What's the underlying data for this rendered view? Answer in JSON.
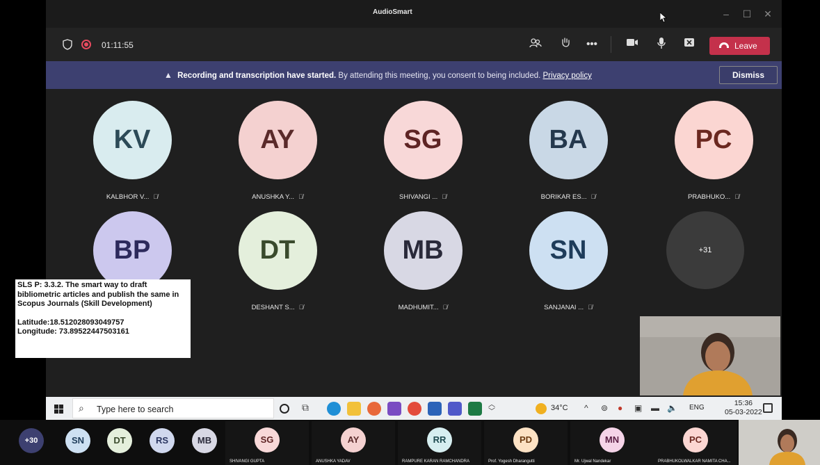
{
  "app": {
    "title": "AudioSmart"
  },
  "window_controls": {
    "minimize": "–",
    "maximize": "☐",
    "close": "✕"
  },
  "meeting": {
    "timer": "01:11:55",
    "leave_label": "Leave",
    "toolbar_icons": [
      "people-icon",
      "raise-hand-icon",
      "more-icon",
      "camera-icon",
      "mic-icon",
      "share-icon"
    ]
  },
  "banner": {
    "bold": "Recording and transcription have started.",
    "text": " By attending this meeting, you consent to being included. ",
    "link": "Privacy policy",
    "dismiss_label": "Dismiss"
  },
  "participants": [
    {
      "initials": "KV",
      "name": "KALBHOR V...",
      "bg": "#d9ecef",
      "fg": "#2c4a57"
    },
    {
      "initials": "AY",
      "name": "ANUSHKA Y...",
      "bg": "#f4d1d0",
      "fg": "#5a2a2a"
    },
    {
      "initials": "SG",
      "name": "SHIVANGI ...",
      "bg": "#f8d8d8",
      "fg": "#5e2424"
    },
    {
      "initials": "BA",
      "name": "BORIKAR ES...",
      "bg": "#c9d8e6",
      "fg": "#24384d"
    },
    {
      "initials": "PC",
      "name": "PRABHUKO...",
      "bg": "#fbd6d2",
      "fg": "#6b2820"
    },
    {
      "initials": "BP",
      "name": "",
      "bg": "#ccc8ee",
      "fg": "#2d2a5c"
    },
    {
      "initials": "DT",
      "name": "DESHANT S...",
      "bg": "#e4efdc",
      "fg": "#394a2c"
    },
    {
      "initials": "MB",
      "name": "MADHUMIT...",
      "bg": "#d8d8e4",
      "fg": "#2a2a3a"
    },
    {
      "initials": "SN",
      "name": "SANJANAI ...",
      "bg": "#cde0f2",
      "fg": "#1e3c5a"
    }
  ],
  "overflow_count": "+31",
  "overlay": {
    "title": "SLS P: 3.3.2. The smart way to draft bibliometric articles and publish the same in Scopus Journals (Skill Development)",
    "latitude": "Latitude:18.512028093049757",
    "longitude": "Longitude: 73.89522447503161"
  },
  "taskbar": {
    "search_placeholder": "Type here to search",
    "weather": "34°C",
    "lang": "ENG",
    "time": "15:36",
    "date": "05-03-2022"
  },
  "strip": {
    "more": "+30",
    "circles": [
      {
        "initials": "SN",
        "bg": "#cde0f2",
        "fg": "#1e3c5a"
      },
      {
        "initials": "DT",
        "bg": "#e4efdc",
        "fg": "#394a2c"
      },
      {
        "initials": "RS",
        "bg": "#d0d8ee",
        "fg": "#2a3560"
      },
      {
        "initials": "MB",
        "bg": "#d8d8e4",
        "fg": "#2a2a3a"
      }
    ],
    "videos": [
      {
        "initials": "SG",
        "name": "SHIVANGI GUPTA",
        "bg": "#f8d8d8",
        "fg": "#5e2424"
      },
      {
        "initials": "AY",
        "name": "ANUSHKA YADAV",
        "bg": "#f4d1d0",
        "fg": "#5a2a2a"
      },
      {
        "initials": "RR",
        "name": "RAMPURE KARAN RAMCHANDRA",
        "bg": "#d6eef0",
        "fg": "#1e4a50"
      },
      {
        "initials": "PD",
        "name": "Prof. Yogesh Dharangutti",
        "bg": "#fde2c4",
        "fg": "#6b3a10"
      },
      {
        "initials": "MN",
        "name": "Mr. Ujwal Nandekar",
        "bg": "#f5d4e8",
        "fg": "#5a1e44"
      },
      {
        "initials": "PC",
        "name": "PRABHUKOLWALKAR NAMITA CHA...",
        "bg": "#fbd6d2",
        "fg": "#6b2820"
      }
    ]
  }
}
